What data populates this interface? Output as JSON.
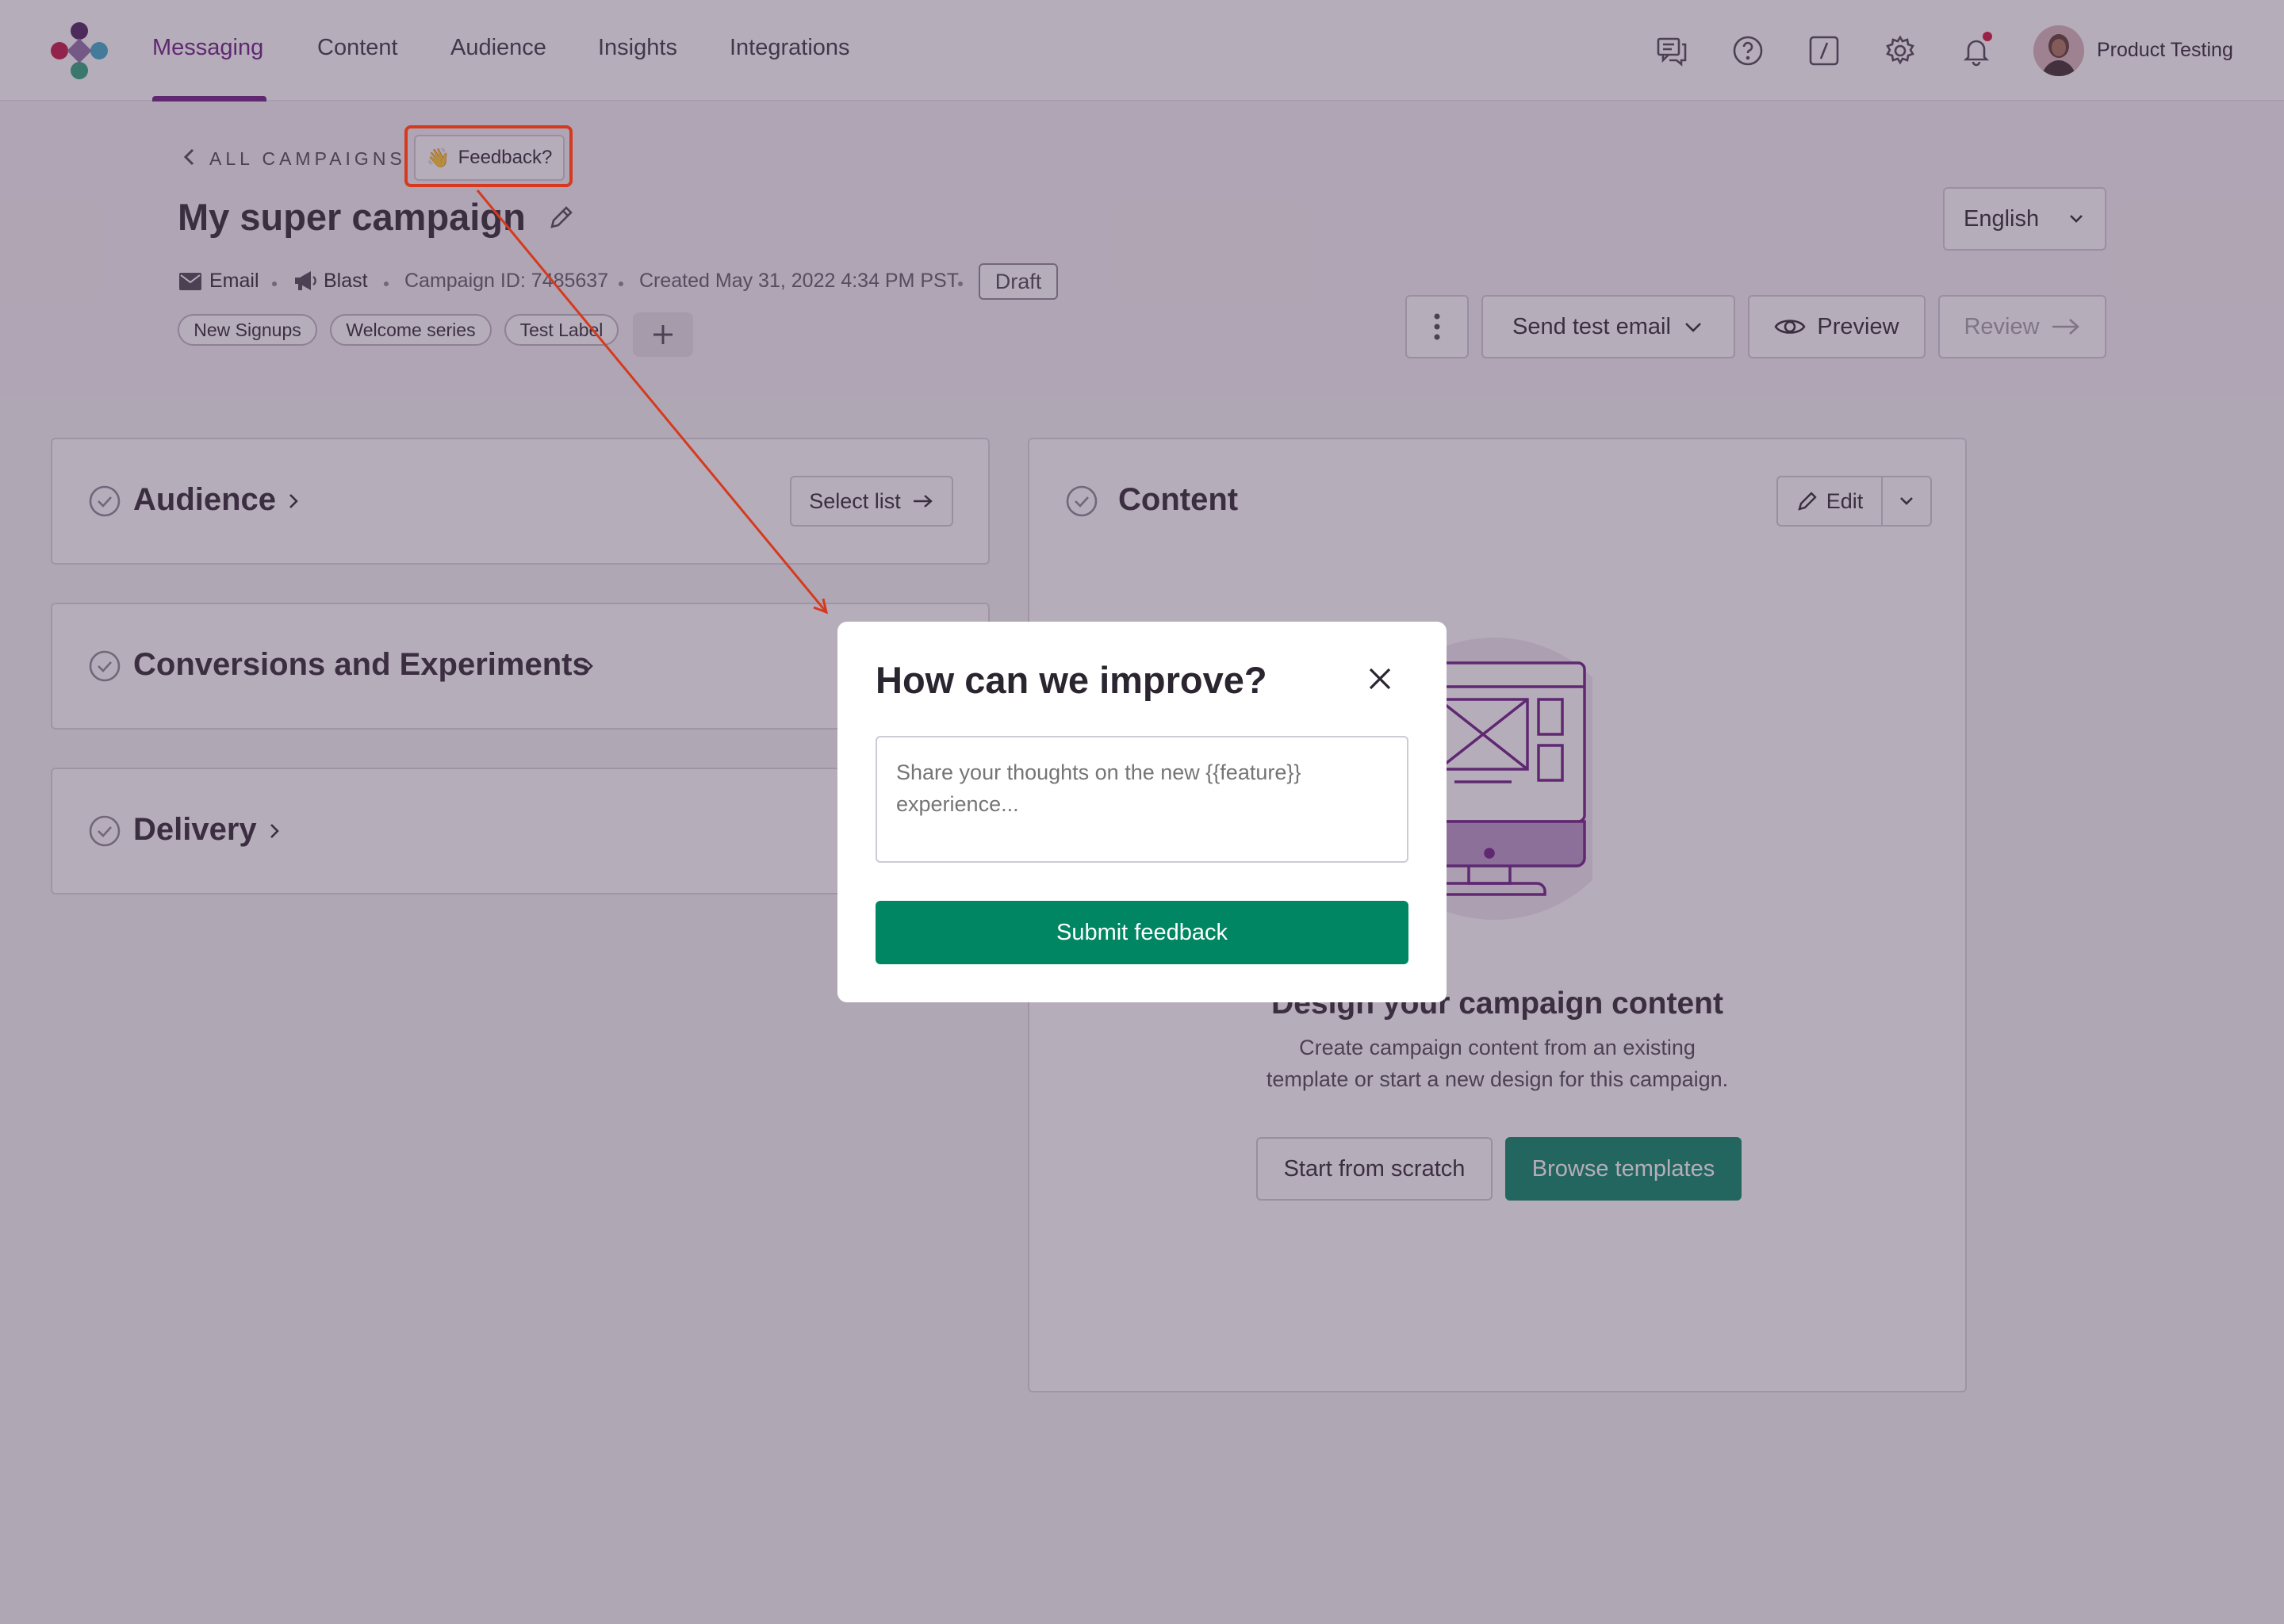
{
  "nav": {
    "tabs": [
      {
        "label": "Messaging",
        "active": true
      },
      {
        "label": "Content"
      },
      {
        "label": "Audience"
      },
      {
        "label": "Insights"
      },
      {
        "label": "Integrations"
      }
    ],
    "icons": [
      "chat-icon",
      "help-icon",
      "slash-command-icon",
      "settings-icon",
      "notifications-icon"
    ],
    "user_name": "Product Testing",
    "notification_dot_color": "#d0103a"
  },
  "header": {
    "back_label": "ALL CAMPAIGNS",
    "feedback_label": "Feedback?",
    "feedback_emoji": "👋",
    "campaign_title": "My super campaign",
    "meta": {
      "channel": "Email",
      "type": "Blast",
      "campaign_id": "Campaign ID: 7485637",
      "created": "Created May 31, 2022 4:34 PM PST",
      "status": "Draft"
    },
    "tags": [
      "New Signups",
      "Welcome series",
      "Test Label"
    ],
    "language": "English",
    "actions": {
      "send_test": "Send test email",
      "preview": "Preview",
      "review": "Review"
    }
  },
  "sections": {
    "audience": {
      "title": "Audience",
      "button": "Select list"
    },
    "conversions": {
      "title": "Conversions and Experiments"
    },
    "delivery": {
      "title": "Delivery"
    }
  },
  "content_panel": {
    "title": "Content",
    "edit_label": "Edit",
    "empty_title": "Design your campaign content",
    "empty_desc_line1": "Create campaign content from an existing",
    "empty_desc_line2": "template or start a new design for this campaign.",
    "scratch_label": "Start from scratch",
    "templates_label": "Browse templates"
  },
  "modal": {
    "title": "How can we improve?",
    "placeholder": "Share your thoughts on the new {{feature}} experience...",
    "submit_label": "Submit feedback"
  },
  "colors": {
    "brand_purple": "#6a1b82",
    "primary_green": "#008662",
    "annotation_red": "#d63a1e"
  }
}
